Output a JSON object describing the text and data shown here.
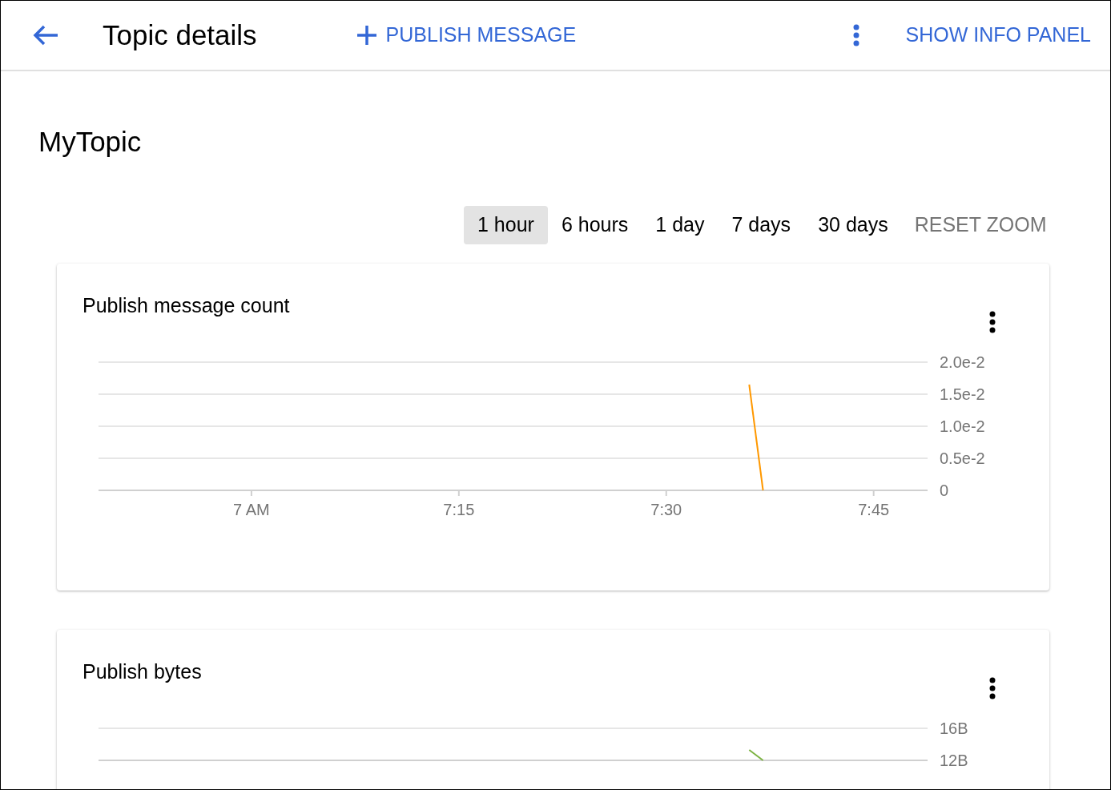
{
  "header": {
    "title": "Topic details",
    "publish_button": "PUBLISH MESSAGE",
    "info_button": "SHOW INFO PANEL"
  },
  "topic_name": "MyTopic",
  "time_ranges": [
    {
      "label": "1 hour",
      "selected": true
    },
    {
      "label": "6 hours",
      "selected": false
    },
    {
      "label": "1 day",
      "selected": false
    },
    {
      "label": "7 days",
      "selected": false
    },
    {
      "label": "30 days",
      "selected": false
    }
  ],
  "reset_zoom": {
    "label": "RESET ZOOM",
    "disabled": true
  },
  "charts": [
    {
      "title": "Publish message count",
      "chart_data": {
        "type": "line",
        "categories": [
          null,
          null,
          null,
          null,
          null,
          null,
          null,
          null,
          null,
          null,
          null,
          "7 AM",
          null,
          null,
          null,
          null,
          null,
          null,
          null,
          null,
          null,
          null,
          null,
          null,
          null,
          null,
          "7:15",
          null,
          null,
          null,
          null,
          null,
          null,
          null,
          null,
          null,
          null,
          null,
          null,
          null,
          null,
          "7:30",
          null,
          null,
          null,
          null,
          null,
          null,
          null,
          null,
          null,
          null,
          null,
          null,
          null,
          null,
          "7:45",
          null,
          null,
          null
        ],
        "ylim": [
          0,
          0.02
        ],
        "grid": true,
        "yticks": [
          {
            "value": 0,
            "label": "0"
          },
          {
            "value": 0.005,
            "label": "0.5e-2"
          },
          {
            "value": 0.01,
            "label": "1.0e-2"
          },
          {
            "value": 0.015,
            "label": "1.5e-2"
          },
          {
            "value": 0.02,
            "label": "2.0e-2"
          }
        ],
        "series": [
          {
            "color": "#ff9800",
            "values": [
              null,
              null,
              null,
              null,
              null,
              null,
              null,
              null,
              null,
              null,
              null,
              null,
              null,
              null,
              null,
              null,
              null,
              null,
              null,
              null,
              null,
              null,
              null,
              null,
              null,
              null,
              null,
              null,
              null,
              null,
              null,
              null,
              null,
              null,
              null,
              null,
              null,
              null,
              null,
              null,
              null,
              null,
              null,
              null,
              null,
              null,
              null,
              0.0165,
              0,
              null,
              null,
              null,
              null,
              null,
              null,
              null,
              null,
              null,
              null,
              null
            ]
          }
        ]
      }
    },
    {
      "title": "Publish bytes",
      "chart_data": {
        "type": "line",
        "categories": [
          null,
          null,
          null,
          null,
          null,
          null,
          null,
          null,
          null,
          null,
          null,
          null,
          null,
          null,
          null,
          null,
          null,
          null,
          null,
          null,
          null,
          null,
          null,
          null,
          null,
          null,
          null,
          null,
          null,
          null,
          null,
          null,
          null,
          null,
          null,
          null,
          null,
          null,
          null,
          null,
          null,
          null,
          null,
          null,
          null,
          null,
          null,
          null,
          null,
          null,
          null,
          null,
          null,
          null,
          null,
          null,
          null,
          null,
          null,
          null
        ],
        "ylim": [
          12,
          16
        ],
        "yticks": [
          {
            "value": 12,
            "label": "12B"
          },
          {
            "value": 16,
            "label": "16B"
          }
        ],
        "series": [
          {
            "color": "#7cb342",
            "values": [
              null,
              null,
              null,
              null,
              null,
              null,
              null,
              null,
              null,
              null,
              null,
              null,
              null,
              null,
              null,
              null,
              null,
              null,
              null,
              null,
              null,
              null,
              null,
              null,
              null,
              null,
              null,
              null,
              null,
              null,
              null,
              null,
              null,
              null,
              null,
              null,
              null,
              null,
              null,
              null,
              null,
              null,
              null,
              null,
              null,
              null,
              null,
              13.3,
              12,
              null,
              null,
              null,
              null,
              null,
              null,
              null,
              null,
              null,
              null,
              null
            ]
          }
        ]
      }
    }
  ]
}
